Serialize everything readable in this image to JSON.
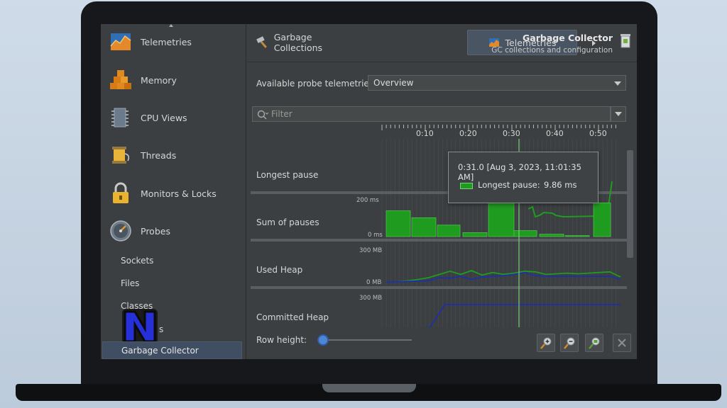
{
  "sidebar": {
    "items": [
      {
        "label": "Telemetries",
        "icon": "telemetry-chart-icon"
      },
      {
        "label": "Memory",
        "icon": "memory-blocks-icon"
      },
      {
        "label": "CPU Views",
        "icon": "cpu-chip-icon"
      },
      {
        "label": "Threads",
        "icon": "threads-spool-icon"
      },
      {
        "label": "Monitors & Locks",
        "icon": "padlock-icon"
      },
      {
        "label": "Probes",
        "icon": "probe-gauge-icon"
      }
    ],
    "sub_items": [
      "Sockets",
      "Files",
      "Classes",
      "s"
    ],
    "selected": "Garbage Collector",
    "logo_text": "N"
  },
  "tabs": [
    {
      "label": "Garbage Collections",
      "icon": "hammer-icon"
    },
    {
      "label": "Telemetries",
      "icon": "telemetry-chart-icon"
    }
  ],
  "header": {
    "title": "Garbage Collector",
    "subtitle": "GC collections and configuration"
  },
  "probe_select": {
    "label": "Available probe telemetries:",
    "value": "Overview"
  },
  "filter": {
    "placeholder": "Filter"
  },
  "timeline": {
    "ticks": [
      "0:10",
      "0:20",
      "0:30",
      "0:40",
      "0:50"
    ],
    "rows": [
      {
        "label": "Longest pause",
        "top_label": "",
        "bottom_label": ""
      },
      {
        "label": "Sum of pauses",
        "top_label": "200 ms",
        "bottom_label": "0 ms"
      },
      {
        "label": "Used Heap",
        "top_label": "300 MB",
        "bottom_label": "0 MB"
      },
      {
        "label": "Committed Heap",
        "top_label": "300 MB",
        "bottom_label": ""
      }
    ],
    "colors": {
      "green": "#1f9c1f",
      "blue": "#1f2fa8",
      "cursor": "#7ad07a"
    }
  },
  "tooltip": {
    "time": "0:31.0 [Aug 3, 2023, 11:01:35 AM]",
    "series": "Longest pause:",
    "value": "9.86 ms"
  },
  "bottom": {
    "row_height_label": "Row height:",
    "row_height_level": 0.05
  },
  "chart_data": {
    "type": "timeline",
    "x_ticks": [
      "0:10",
      "0:20",
      "0:30",
      "0:40",
      "0:50"
    ],
    "sum_of_pauses_bars_ms": [
      130,
      95,
      58,
      20,
      190,
      30,
      12,
      5,
      170
    ],
    "longest_pause_cursor": {
      "time": "0:31.0",
      "value_ms": 9.86
    },
    "used_heap_mb": {
      "green": [
        10,
        12,
        20,
        30,
        45,
        70,
        95,
        70,
        100,
        65,
        85,
        70,
        80,
        95,
        90,
        70,
        75,
        80,
        75,
        80,
        85,
        90,
        50
      ],
      "blue": [
        10,
        12,
        15,
        18,
        20,
        45,
        40,
        55,
        30,
        50,
        55,
        60,
        70,
        85,
        60,
        55,
        55,
        55,
        55,
        55,
        55,
        55,
        30
      ]
    },
    "committed_heap_mb": {
      "blue": [
        5,
        20,
        30,
        40,
        200,
        200,
        200,
        200,
        200,
        200,
        200,
        200,
        200,
        200,
        200,
        200,
        200
      ]
    }
  }
}
